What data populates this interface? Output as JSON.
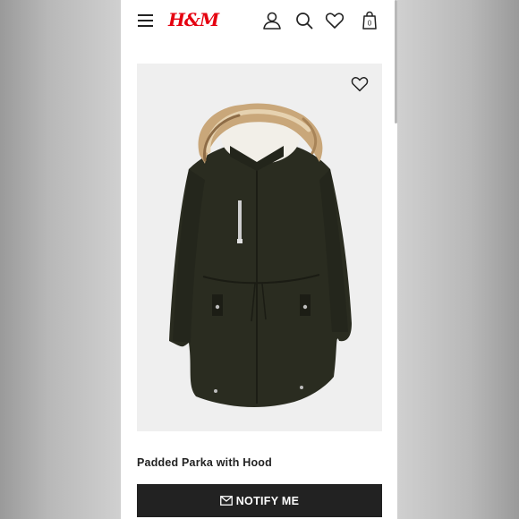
{
  "header": {
    "logo": "H&M",
    "icons": [
      "menu-icon",
      "account-icon",
      "search-icon",
      "wishlist-icon",
      "bag-icon"
    ],
    "bag_count": "0"
  },
  "product": {
    "name": "Padded Parka with Hood",
    "image_alt": "Dark green padded parka with faux fur trimmed hood",
    "colors": {
      "parka": "#2a2c20",
      "fur": "#c9a77a",
      "background": "#efefef"
    }
  },
  "actions": {
    "notify_label": "NOTIFY ME"
  },
  "colors": {
    "brand": "#e50010",
    "button": "#222222"
  }
}
